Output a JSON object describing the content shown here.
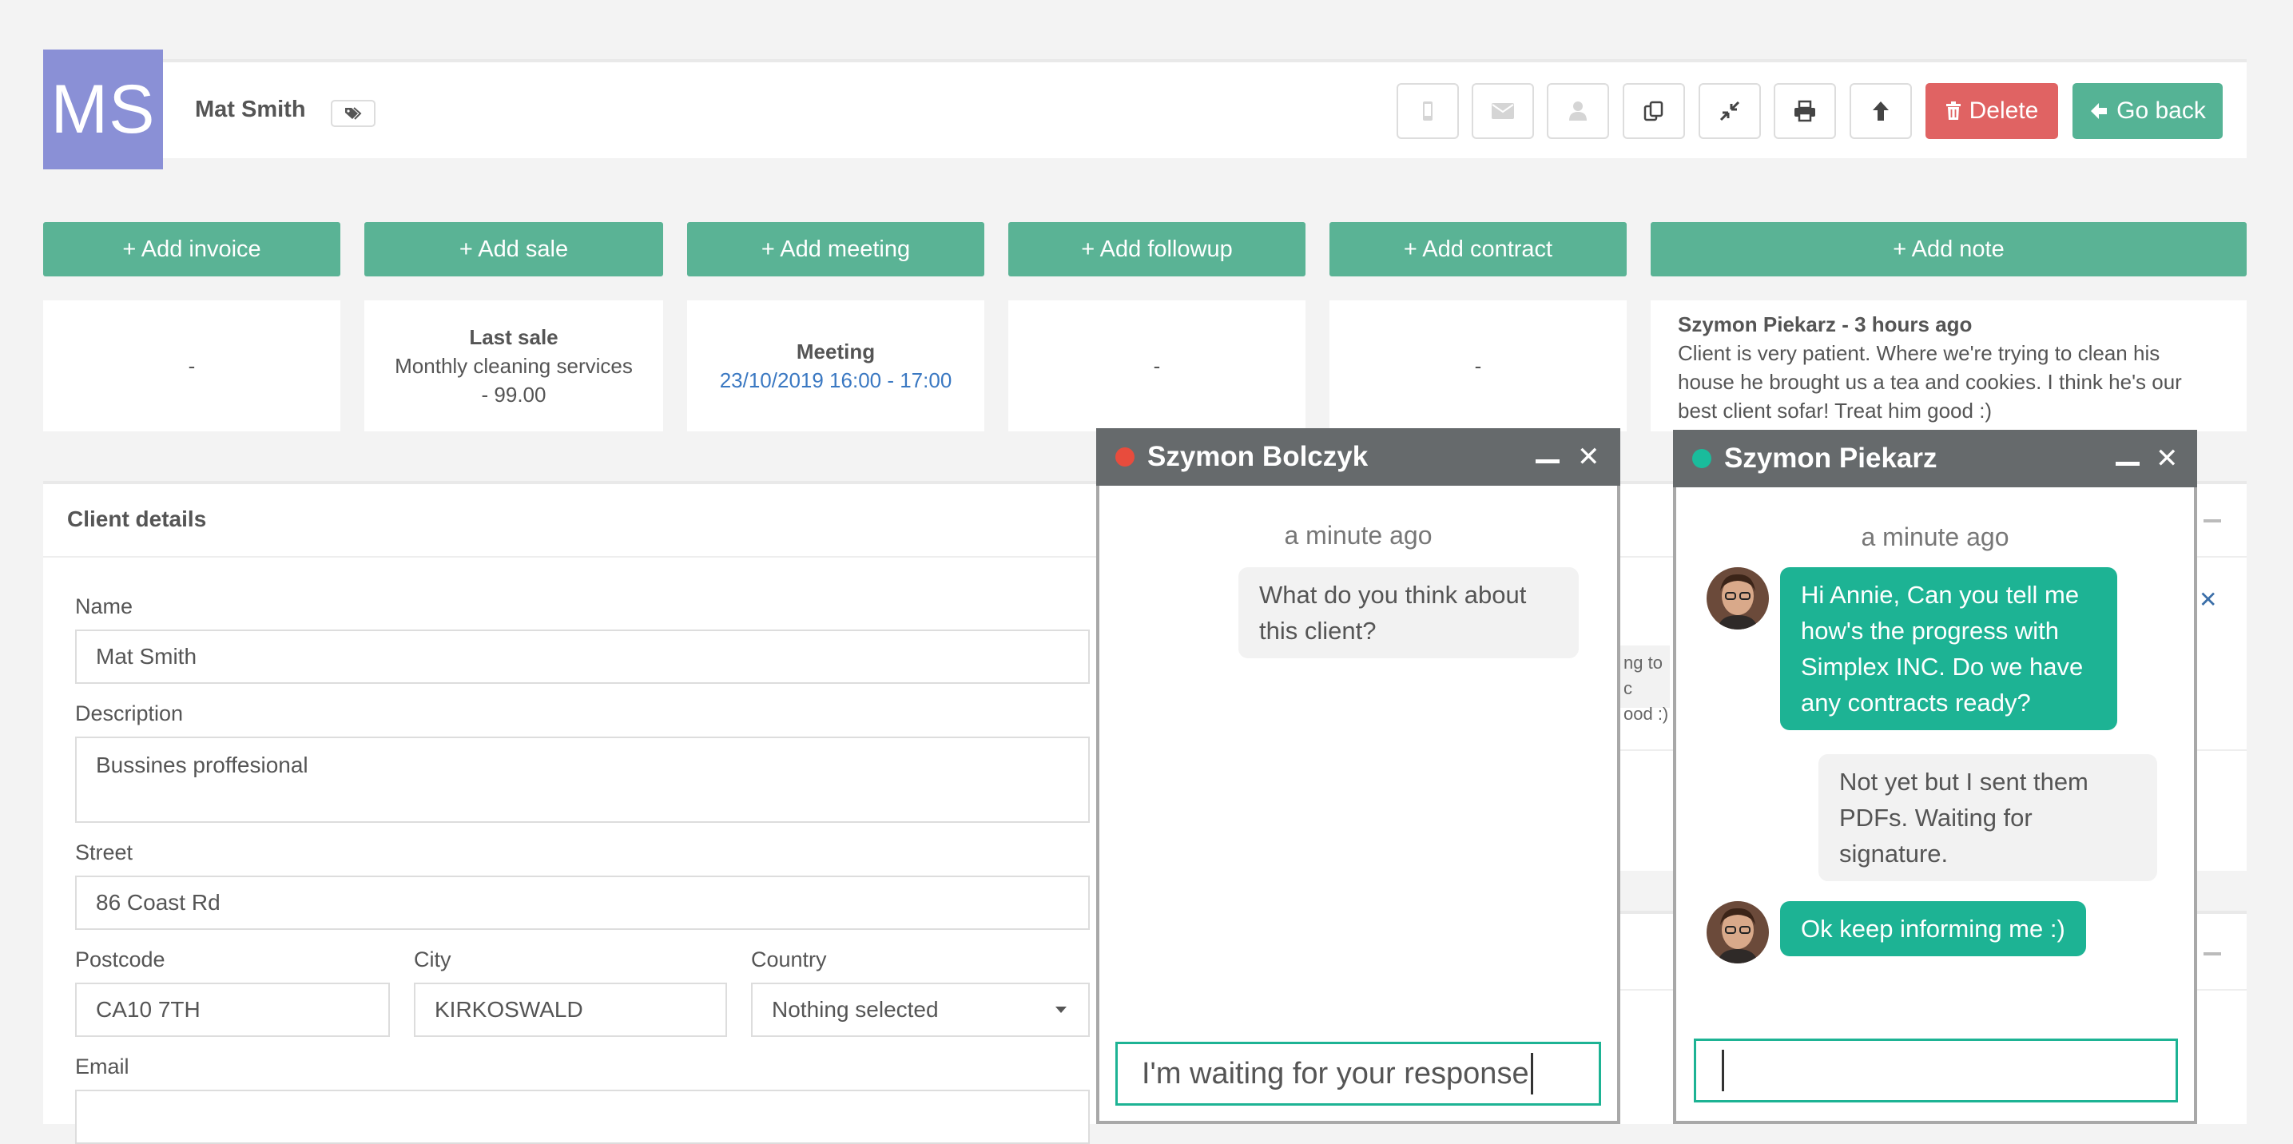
{
  "header": {
    "avatar_initials": "MS",
    "client_name": "Mat Smith",
    "delete_label": "Delete",
    "back_label": "Go back"
  },
  "actions": [
    "+ Add invoice",
    "+ Add sale",
    "+ Add meeting",
    "+ Add followup",
    "+ Add contract",
    "+ Add note"
  ],
  "cards": {
    "invoice": "-",
    "sale_title": "Last sale",
    "sale_line1": "Monthly cleaning services",
    "sale_line2": "- 99.00",
    "meeting_title": "Meeting",
    "meeting_time": "23/10/2019 16:00 - 17:00",
    "followup": "-",
    "contract": "-",
    "note_author": "Szymon Piekarz - 3 hours ago",
    "note_text": "Client is very patient. Where we're trying to clean his house he brought us a tea and cookies. I think he's our best client sofar! Treat him good :)"
  },
  "details": {
    "title": "Client details",
    "name_label": "Name",
    "name_value": "Mat Smith",
    "description_label": "Description",
    "description_value": "Bussines proffesional",
    "street_label": "Street",
    "street_value": "86 Coast Rd",
    "postcode_label": "Postcode",
    "postcode_value": "CA10 7TH",
    "city_label": "City",
    "city_value": "KIRKOSWALD",
    "country_label": "Country",
    "country_value": "Nothing selected",
    "email_label": "Email",
    "email_value": ""
  },
  "hidden_text": {
    "line1": "ng to c",
    "line2": "ood :)"
  },
  "chat1": {
    "name": "Szymon Bolczyk",
    "status_color": "#e84c3d",
    "time": "a minute ago",
    "message": "What do you think about this client?",
    "input_value": "I'm waiting for your response"
  },
  "chat2": {
    "name": "Szymon Piekarz",
    "status_color": "#1abc9c",
    "time": "a minute ago",
    "msg1": "Hi Annie, Can you tell me how's the progress with Simplex INC. Do we have any contracts ready?",
    "msg2": "Not yet but I sent them PDFs. Waiting for signature.",
    "msg3": "Ok keep informing me :)",
    "input_value": ""
  }
}
